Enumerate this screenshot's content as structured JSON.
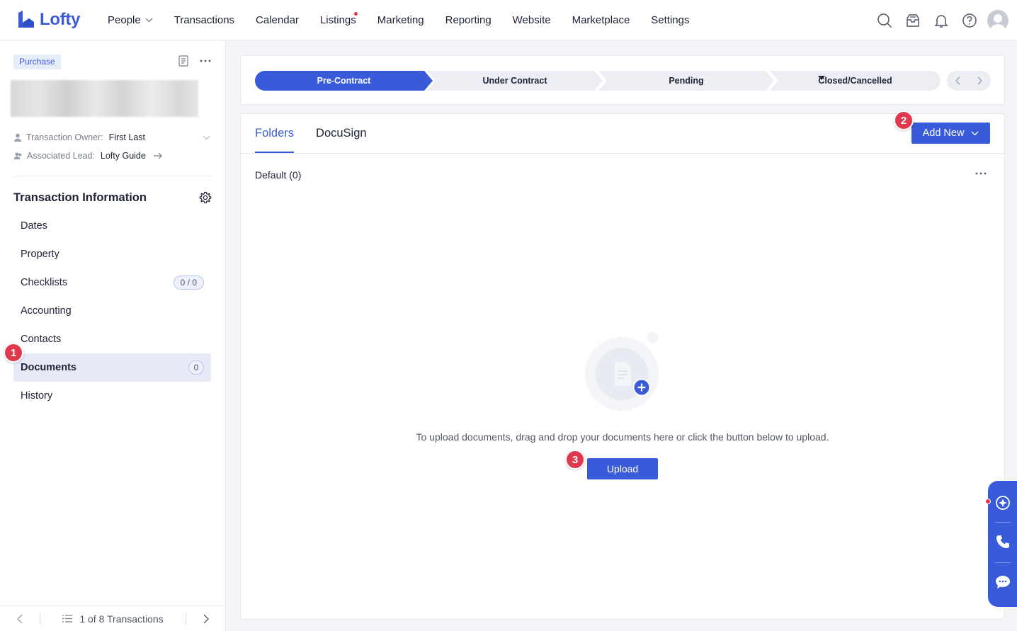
{
  "brand": {
    "name": "Lofty",
    "color": "#3a5bd9"
  },
  "nav": {
    "items": [
      {
        "label": "People",
        "has_dropdown": true
      },
      {
        "label": "Transactions"
      },
      {
        "label": "Calendar"
      },
      {
        "label": "Listings",
        "has_dot": true
      },
      {
        "label": "Marketing"
      },
      {
        "label": "Reporting"
      },
      {
        "label": "Website"
      },
      {
        "label": "Marketplace"
      },
      {
        "label": "Settings"
      }
    ],
    "right_icons": [
      "search-icon",
      "inbox-icon",
      "bell-icon",
      "help-icon"
    ]
  },
  "sidebar": {
    "tag": "Purchase",
    "owner_label": "Transaction Owner:",
    "owner_value": "First Last",
    "lead_label": "Associated Lead:",
    "lead_value": "Lofty Guide",
    "section_title": "Transaction Information",
    "items": [
      {
        "label": "Dates"
      },
      {
        "label": "Property"
      },
      {
        "label": "Checklists",
        "badge": "0 / 0"
      },
      {
        "label": "Accounting"
      },
      {
        "label": "Contacts"
      },
      {
        "label": "Documents",
        "badge": "0",
        "active": true
      },
      {
        "label": "History"
      }
    ],
    "pager_text": "1 of 8 Transactions"
  },
  "stages": {
    "items": [
      "Pre-Contract",
      "Under Contract",
      "Pending",
      "Closed/Cancelled"
    ],
    "active_index": 0
  },
  "documents": {
    "tabs": [
      "Folders",
      "DocuSign"
    ],
    "active_tab": "Folders",
    "add_new_label": "Add New",
    "folder_title": "Default (0)",
    "empty_text": "To upload documents, drag and drop your documents here or click the button below to upload.",
    "upload_label": "Upload"
  },
  "markers": [
    "1",
    "2",
    "3"
  ],
  "colors": {
    "accent": "#3a5bd9",
    "marker": "#e0384d",
    "stage_inactive": "#eceef3"
  }
}
